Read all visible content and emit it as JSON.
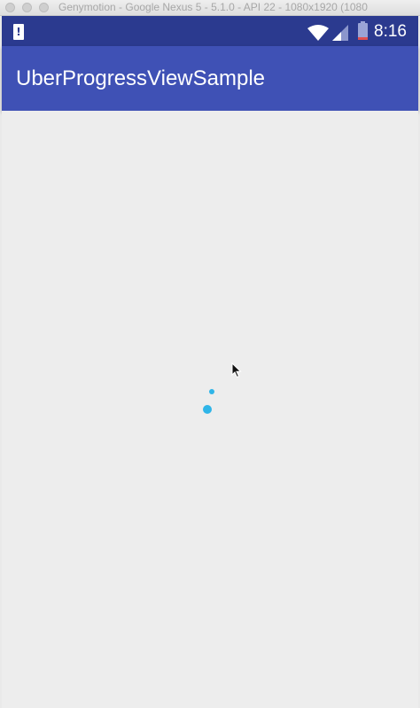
{
  "window": {
    "title": "Genymotion - Google Nexus 5 - 5.1.0 - API 22 - 1080x1920 (1080"
  },
  "status_bar": {
    "time": "8:16",
    "alert_glyph": "!",
    "icons": [
      "alert-icon",
      "wifi-icon",
      "cellular-signal-icon",
      "battery-icon"
    ]
  },
  "app_bar": {
    "title": "UberProgressViewSample"
  },
  "colors": {
    "status_bar": "#2b3a8f",
    "app_bar": "#3f51b5",
    "background": "#ededed",
    "progress_dot": "#2fb5e8"
  }
}
